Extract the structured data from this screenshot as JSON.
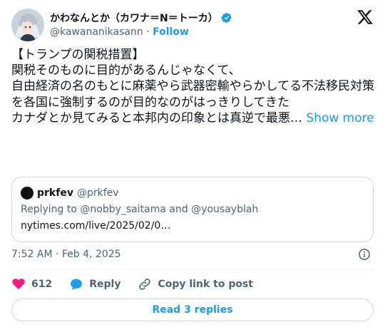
{
  "author": {
    "display_name": "かわなんとか（カワナ＝N＝トーカ）",
    "handle": "@kawananikasann",
    "separator": "·",
    "follow_label": "Follow"
  },
  "tweet": {
    "text": "【トランプの関税措置】\n関税そのものに目的があるんじゃなくて、\n自由経済の名のもとに麻薬やら武器密輸やらかしてる不法移民対策を各国に強制するのが目的なのがはっきりしてきた\nカナダとか見てみると本邦内の印象とは真逆で最悪… ",
    "show_more": "Show more"
  },
  "quote": {
    "name": "prkfev",
    "handle": "@prkfev",
    "replying_prefix": "Replying to ",
    "mention_1": "@nobby_saitama",
    "and_word": " and ",
    "mention_2": "@yousayblah",
    "link": "nytimes.com/live/2025/02/0…"
  },
  "meta": {
    "timestamp": "7:52 AM · Feb 4, 2025"
  },
  "actions": {
    "like_count": "612",
    "reply_label": "Reply",
    "copy_label": "Copy link to post"
  },
  "read_replies_label": "Read 3 replies",
  "colors": {
    "accent": "#1d9bf0",
    "like": "#f91880",
    "text": "#0f1419",
    "muted": "#536471"
  },
  "icons": [
    "avatar",
    "verified-badge-icon",
    "x-logo-icon",
    "info-icon",
    "heart-icon",
    "reply-bubble-icon",
    "link-icon"
  ]
}
